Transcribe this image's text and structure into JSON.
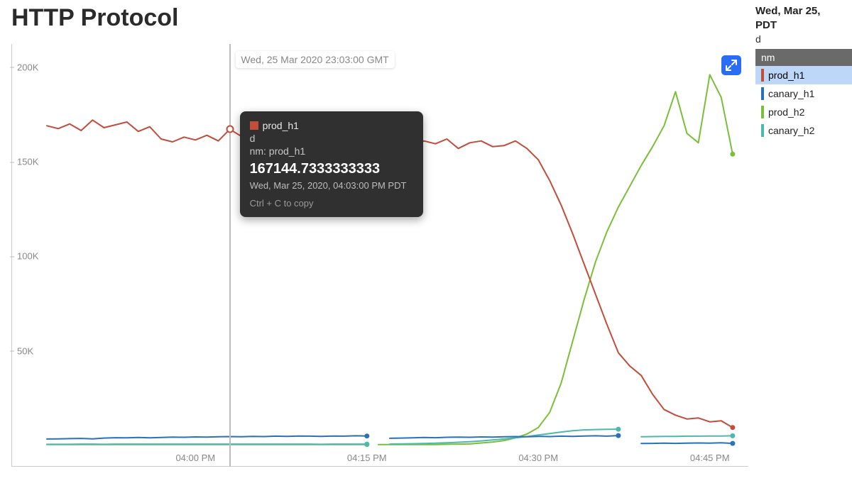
{
  "title": "HTTP Protocol",
  "side": {
    "header": "Wed, Mar 25, ",
    "tz": "PDT",
    "dim_label": "d"
  },
  "legend": {
    "header": "nm",
    "items": [
      {
        "name": "prod_h1",
        "color": "#c24d3a",
        "selected": true
      },
      {
        "name": "canary_h1",
        "color": "#2a71b8",
        "selected": false
      },
      {
        "name": "prod_h2",
        "color": "#7abf3a",
        "selected": false
      },
      {
        "name": "canary_h2",
        "color": "#4cb8b0",
        "selected": false
      }
    ]
  },
  "yticks": [
    {
      "label": "200K",
      "value": 200000
    },
    {
      "label": "150K",
      "value": 150000
    },
    {
      "label": "100K",
      "value": 100000
    },
    {
      "label": "50K",
      "value": 50000
    }
  ],
  "xticks": [
    {
      "label": "04:00 PM",
      "minute": 0
    },
    {
      "label": "04:15 PM",
      "minute": 15
    },
    {
      "label": "04:30 PM",
      "minute": 30
    },
    {
      "label": "04:45 PM",
      "minute": 45
    }
  ],
  "hover": {
    "minute": 3,
    "time_label_gmt": "Wed, 25 Mar 2020 23:03:00 GMT",
    "series_name": "prod_h1",
    "dim": "d",
    "nm_line": "nm: prod_h1",
    "value_text": "167144.7333333333",
    "timestamp_local": "Wed, Mar 25, 2020, 04:03:00 PM PDT",
    "copy_hint": "Ctrl + C to copy",
    "swatch_color": "#c24d3a",
    "marker_y": 167144.7333333333
  },
  "expand_button": {
    "title": "Expand"
  },
  "chart_data": {
    "type": "line",
    "title": "HTTP Protocol",
    "xlabel": "",
    "ylabel": "",
    "x_unit": "minutes past 04:00 PM PDT, Wed Mar 25 2020",
    "x_range_min": -13,
    "x_range_max": 48,
    "ylim": [
      0,
      210000
    ],
    "grid": false,
    "legend_position": "right",
    "series": [
      {
        "name": "prod_h1",
        "color": "#c24d3a",
        "x": [
          -13,
          -12,
          -11,
          -10,
          -9,
          -8,
          -7,
          -6,
          -5,
          -4,
          -3,
          -2,
          -1,
          0,
          1,
          2,
          3,
          4,
          5,
          6,
          7,
          8,
          9,
          10,
          11,
          12,
          13,
          14,
          15,
          16,
          17,
          18,
          19,
          20,
          21,
          22,
          23,
          24,
          25,
          26,
          27,
          28,
          29,
          30,
          31,
          32,
          33,
          34,
          35,
          36,
          37,
          38,
          39,
          40,
          41,
          42,
          43,
          44,
          45,
          46,
          47
        ],
        "values": [
          169000,
          167500,
          170000,
          166500,
          172000,
          168000,
          169500,
          171000,
          166000,
          168500,
          162000,
          160500,
          163000,
          161500,
          164000,
          161000,
          167145,
          163500,
          166000,
          160000,
          162500,
          163500,
          161000,
          164000,
          159000,
          162000,
          160000,
          162500,
          160500,
          161000,
          156000,
          159000,
          158000,
          161000,
          159500,
          162000,
          157000,
          160000,
          161000,
          158000,
          158500,
          161000,
          157000,
          151000,
          140000,
          127000,
          112000,
          96000,
          80000,
          64000,
          49000,
          42000,
          37000,
          27000,
          19000,
          16000,
          14000,
          14500,
          12500,
          13000,
          9500
        ]
      },
      {
        "name": "canary_h1",
        "color": "#2a71b8",
        "segments": [
          {
            "x": [
              -13,
              -12,
              -11,
              -10,
              -9,
              -8,
              -7,
              -6,
              -5,
              -4,
              -3,
              -2,
              -1,
              0,
              1,
              2,
              3,
              4,
              5,
              6,
              7,
              8,
              9,
              10,
              11,
              12,
              13,
              14,
              15
            ],
            "values": [
              3400,
              3500,
              3600,
              3700,
              3500,
              3900,
              4100,
              4000,
              4200,
              4000,
              4200,
              4400,
              4300,
              4500,
              4400,
              4600,
              4700,
              4600,
              4800,
              4700,
              4900,
              4800,
              5000,
              4900,
              4800,
              5000,
              4900,
              5100,
              5000
            ]
          },
          {
            "x": [
              17,
              18,
              19,
              20,
              21,
              22,
              23,
              24,
              25,
              26,
              27,
              28,
              29,
              30,
              31,
              32,
              33,
              34,
              35,
              36,
              37
            ],
            "values": [
              3800,
              3900,
              4000,
              4200,
              4100,
              4300,
              4400,
              4300,
              4500,
              4400,
              4600,
              4700,
              4600,
              4800,
              4700,
              4900,
              4800,
              5000,
              5100,
              4900,
              5200
            ]
          },
          {
            "x": [
              39,
              40,
              41,
              42,
              43,
              44,
              45,
              46,
              47
            ],
            "values": [
              1000,
              1100,
              1200,
              1100,
              1200,
              1300,
              1200,
              1400,
              1100
            ]
          }
        ]
      },
      {
        "name": "prod_h2",
        "color": "#7abf3a",
        "segments": [
          {
            "x": [
              -13,
              -12,
              -11,
              -10,
              -9,
              -8,
              -7,
              -6,
              -5,
              -4,
              -3,
              -2,
              -1,
              0,
              1,
              2,
              3,
              4,
              5,
              6,
              7,
              8,
              9,
              10,
              11,
              12,
              13,
              14,
              15
            ],
            "values": [
              500,
              500,
              500,
              500,
              500,
              500,
              500,
              500,
              500,
              500,
              500,
              500,
              500,
              500,
              500,
              500,
              500,
              500,
              500,
              500,
              500,
              500,
              500,
              500,
              500,
              500,
              500,
              500,
              500
            ]
          },
          {
            "x": [
              16,
              17,
              18,
              19,
              20,
              21,
              22,
              23,
              24,
              25,
              26,
              27,
              28,
              29,
              30,
              31,
              32,
              33,
              34,
              35,
              36,
              37,
              38,
              39,
              40,
              41,
              42,
              43,
              44,
              45,
              46,
              47
            ],
            "values": [
              500,
              500,
              500,
              500,
              500,
              500,
              600,
              700,
              800,
              1300,
              1800,
              2600,
              4000,
              6000,
              9500,
              17500,
              33000,
              55000,
              77000,
              97000,
              113000,
              126000,
              137000,
              148000,
              158000,
              169000,
              187000,
              165000,
              160000,
              196000,
              184000,
              154000
            ]
          }
        ]
      },
      {
        "name": "canary_h2",
        "color": "#4cb8b0",
        "segments": [
          {
            "x": [
              -13,
              -12,
              -11,
              -10,
              -9,
              -8,
              -7,
              -6,
              -5,
              -4,
              -3,
              -2,
              -1,
              0,
              1,
              2,
              3,
              4,
              5,
              6,
              7,
              8,
              9,
              10,
              11,
              12,
              13,
              14,
              15
            ],
            "values": [
              600,
              600,
              600,
              700,
              700,
              600,
              700,
              700,
              700,
              700,
              700,
              700,
              700,
              700,
              700,
              700,
              700,
              700,
              700,
              700,
              700,
              700,
              700,
              700,
              600,
              700,
              700,
              700,
              700
            ]
          },
          {
            "x": [
              17,
              18,
              19,
              20,
              21,
              22,
              23,
              24,
              25,
              26,
              27,
              28,
              29,
              30,
              31,
              32,
              33,
              34,
              35,
              36,
              37
            ],
            "values": [
              700,
              800,
              900,
              1000,
              1200,
              1400,
              1700,
              2000,
              2400,
              2900,
              3400,
              4000,
              4700,
              5500,
              6300,
              7100,
              7800,
              8200,
              8400,
              8500,
              8600
            ]
          },
          {
            "x": [
              39,
              40,
              41,
              42,
              43,
              44,
              45,
              46,
              47
            ],
            "values": [
              4600,
              4700,
              4800,
              4800,
              4900,
              4900,
              5000,
              5000,
              5100
            ]
          }
        ]
      }
    ]
  }
}
